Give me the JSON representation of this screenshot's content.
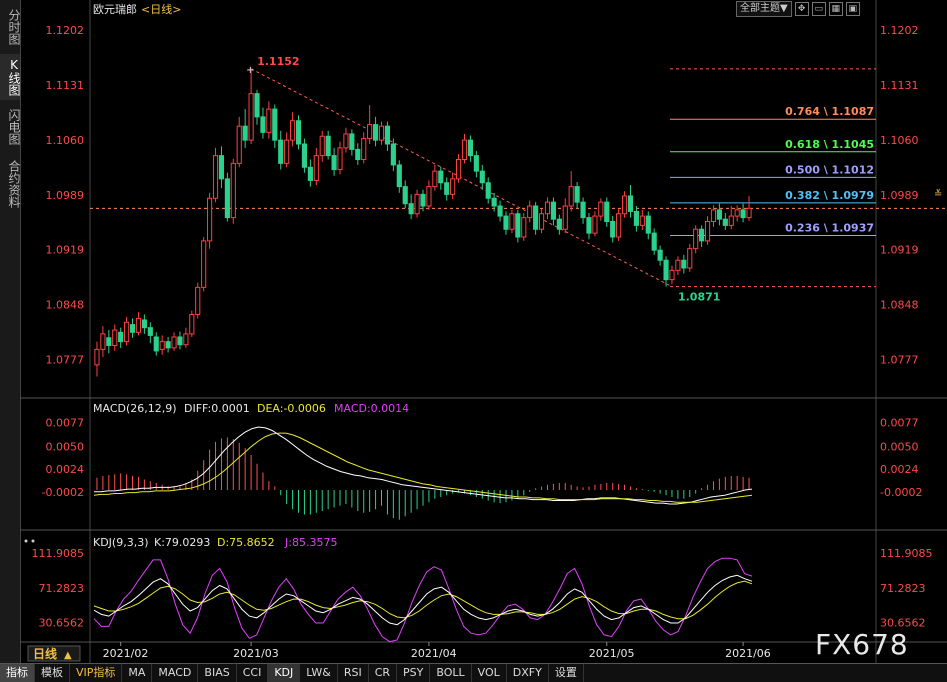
{
  "sidebar": {
    "tabs": [
      {
        "label": "分时图",
        "active": false
      },
      {
        "label": "K线图",
        "active": true
      },
      {
        "label": "闪电图",
        "active": false
      },
      {
        "label": "合约资料",
        "active": false
      }
    ]
  },
  "header": {
    "symbol": "欧元瑞郎",
    "period": "<日线>",
    "theme_button": "全部主题",
    "theme_caret": "▼"
  },
  "main_chart": {
    "price_ticks": [
      "1.1202",
      "1.1131",
      "1.1060",
      "1.0989",
      "1.0919",
      "1.0848",
      "1.0777"
    ],
    "high_label": "1.1152",
    "low_label": "1.0871",
    "fib_levels": [
      {
        "label": "0.764 \\ 1.1087",
        "color": "#ff8c5a"
      },
      {
        "label": "0.618 \\ 1.1045",
        "color": "#4cff4c"
      },
      {
        "label": "0.500 \\ 1.1012",
        "color": "#a0a0ff"
      },
      {
        "label": "0.382 \\ 1.0979",
        "color": "#4fc3f7"
      },
      {
        "label": "0.236 \\ 1.0937",
        "color": "#a0a0ff"
      }
    ],
    "last_price_marker": "≚"
  },
  "macd": {
    "title": "MACD(26,12,9)",
    "diff": "DIFF:0.0001",
    "dea": "DEA:-0.0006",
    "macd": "MACD:0.0014",
    "ticks": [
      "0.0077",
      "0.0050",
      "0.0024",
      "-0.0002"
    ]
  },
  "kdj": {
    "title": "KDJ(9,3,3)",
    "k": "K:79.0293",
    "d": "D:75.8652",
    "j": "J:85.3575",
    "ticks": [
      "111.9085",
      "71.2823",
      "30.6562"
    ]
  },
  "x_axis": {
    "period_button": "日线",
    "dates": [
      "2021/02",
      "2021/03",
      "2021/04",
      "2021/05",
      "2021/06"
    ]
  },
  "bottom_tabs": [
    "指标",
    "模板",
    "VIP指标",
    "MA",
    "MACD",
    "BIAS",
    "CCI",
    "KDJ",
    "LW&",
    "RSI",
    "CR",
    "PSY",
    "BOLL",
    "VOL",
    "DXFY",
    "设置"
  ],
  "watermark": "FX678",
  "colors": {
    "up": "#ff4040",
    "down": "#2bd18c",
    "axis": "#ff4848",
    "diff_line": "#ffffff",
    "dea_line": "#e8e830",
    "j_line": "#e040fb"
  },
  "chart_data": {
    "type": "candlestick",
    "title": "欧元瑞郎 日线",
    "y_range": [
      1.0735,
      1.1215
    ],
    "x_labels": [
      "2021/02",
      "2021/03",
      "2021/04",
      "2021/05",
      "2021/06"
    ],
    "candles": [
      [
        1.077,
        1.079,
        1.0755,
        1.08
      ],
      [
        1.079,
        1.081,
        1.078,
        1.082
      ],
      [
        1.0805,
        1.0795,
        1.0785,
        1.0815
      ],
      [
        1.0795,
        1.0815,
        1.0788,
        1.0822
      ],
      [
        1.0812,
        1.08,
        1.0792,
        1.0818
      ],
      [
        1.08,
        1.0825,
        1.0795,
        1.0832
      ],
      [
        1.0822,
        1.0812,
        1.0805,
        1.083
      ],
      [
        1.0812,
        1.083,
        1.0808,
        1.0838
      ],
      [
        1.0828,
        1.0818,
        1.081,
        1.0835
      ],
      [
        1.0818,
        1.0808,
        1.0798,
        1.0825
      ],
      [
        1.0806,
        1.0788,
        1.0782,
        1.0812
      ],
      [
        1.079,
        1.08,
        1.0783,
        1.0808
      ],
      [
        1.08,
        1.0792,
        1.0786,
        1.0806
      ],
      [
        1.0792,
        1.0806,
        1.0788,
        1.0812
      ],
      [
        1.0806,
        1.0796,
        1.079,
        1.0813
      ],
      [
        1.0796,
        1.081,
        1.0792,
        1.0818
      ],
      [
        1.081,
        1.0835,
        1.0806,
        1.084
      ],
      [
        1.0835,
        1.087,
        1.083,
        1.0876
      ],
      [
        1.087,
        1.093,
        1.0865,
        1.0935
      ],
      [
        1.093,
        1.0985,
        1.092,
        1.0992
      ],
      [
        1.0985,
        1.104,
        1.098,
        1.105
      ],
      [
        1.104,
        1.101,
        1.0998,
        1.1052
      ],
      [
        1.101,
        1.096,
        1.0955,
        1.1018
      ],
      [
        1.096,
        1.103,
        1.0952,
        1.1036
      ],
      [
        1.103,
        1.1078,
        1.1025,
        1.109
      ],
      [
        1.1078,
        1.106,
        1.105,
        1.11
      ],
      [
        1.106,
        1.112,
        1.1055,
        1.1152
      ],
      [
        1.112,
        1.109,
        1.108,
        1.1125
      ],
      [
        1.109,
        1.107,
        1.1062,
        1.1102
      ],
      [
        1.107,
        1.11,
        1.1062,
        1.111
      ],
      [
        1.11,
        1.106,
        1.105,
        1.1106
      ],
      [
        1.106,
        1.103,
        1.1022,
        1.1072
      ],
      [
        1.103,
        1.106,
        1.1025,
        1.107
      ],
      [
        1.106,
        1.1085,
        1.1052,
        1.1096
      ],
      [
        1.1085,
        1.1055,
        1.1048,
        1.1092
      ],
      [
        1.1055,
        1.1025,
        1.1018,
        1.1062
      ],
      [
        1.1025,
        1.1008,
        1.1,
        1.1035
      ],
      [
        1.1008,
        1.104,
        1.1002,
        1.105
      ],
      [
        1.104,
        1.1065,
        1.1032,
        1.1072
      ],
      [
        1.1065,
        1.104,
        1.1035,
        1.1072
      ],
      [
        1.104,
        1.1022,
        1.1014,
        1.105
      ],
      [
        1.1022,
        1.105,
        1.1016,
        1.1058
      ],
      [
        1.105,
        1.1068,
        1.1044,
        1.1076
      ],
      [
        1.1068,
        1.1048,
        1.104,
        1.1074
      ],
      [
        1.1048,
        1.1035,
        1.1028,
        1.1056
      ],
      [
        1.1035,
        1.1062,
        1.103,
        1.107
      ],
      [
        1.1062,
        1.108,
        1.1055,
        1.1105
      ],
      [
        1.108,
        1.106,
        1.1052,
        1.109
      ],
      [
        1.106,
        1.1078,
        1.1054,
        1.1084
      ],
      [
        1.1078,
        1.1055,
        1.1046,
        1.1084
      ],
      [
        1.1055,
        1.1028,
        1.102,
        1.1062
      ],
      [
        1.1028,
        1.1,
        1.0992,
        1.1034
      ],
      [
        1.1,
        1.0978,
        1.0972,
        1.1008
      ],
      [
        1.0978,
        1.0965,
        1.0958,
        1.099
      ],
      [
        1.0965,
        1.099,
        1.096,
        1.0996
      ],
      [
        1.099,
        1.0975,
        1.0968,
        1.0996
      ],
      [
        1.0975,
        1.1,
        1.097,
        1.1008
      ],
      [
        1.1,
        1.102,
        1.0995,
        1.1028
      ],
      [
        1.102,
        1.1005,
        1.0996,
        1.1026
      ],
      [
        1.1005,
        1.099,
        1.0982,
        1.1012
      ],
      [
        1.099,
        1.101,
        1.0984,
        1.1018
      ],
      [
        1.101,
        1.1035,
        1.1005,
        1.1042
      ],
      [
        1.1035,
        1.106,
        1.103,
        1.1068
      ],
      [
        1.106,
        1.104,
        1.1032,
        1.1066
      ],
      [
        1.104,
        1.102,
        1.1012,
        1.1046
      ],
      [
        1.102,
        1.1005,
        1.0996,
        1.1028
      ],
      [
        1.1005,
        1.0985,
        1.0978,
        1.1012
      ],
      [
        1.0985,
        1.0975,
        1.0968,
        1.0992
      ],
      [
        1.0975,
        1.0962,
        1.0955,
        1.0982
      ],
      [
        1.0962,
        1.0945,
        1.0938,
        1.0968
      ],
      [
        1.0945,
        1.0965,
        1.094,
        1.097
      ],
      [
        1.0965,
        1.0935,
        1.0928,
        1.097
      ],
      [
        1.0935,
        1.096,
        1.093,
        1.0966
      ],
      [
        1.096,
        1.0975,
        1.0954,
        1.0982
      ],
      [
        1.0975,
        1.0945,
        1.0938,
        1.098
      ],
      [
        1.0945,
        1.0965,
        1.094,
        1.0972
      ],
      [
        1.0965,
        1.098,
        1.0958,
        1.0986
      ],
      [
        1.098,
        1.0958,
        1.095,
        1.0986
      ],
      [
        1.0958,
        1.0945,
        1.0938,
        1.0964
      ],
      [
        1.0945,
        1.0975,
        1.094,
        1.0985
      ],
      [
        1.0975,
        1.1,
        1.0968,
        1.102
      ],
      [
        1.1,
        1.098,
        1.0972,
        1.1006
      ],
      [
        1.098,
        1.096,
        1.0952,
        1.0986
      ],
      [
        1.096,
        1.094,
        1.0932,
        1.0966
      ],
      [
        1.094,
        1.0962,
        1.0936,
        1.0968
      ],
      [
        1.0962,
        1.098,
        1.0956,
        1.0985
      ],
      [
        1.098,
        1.0955,
        1.0948,
        1.0986
      ],
      [
        1.0955,
        1.0935,
        1.0928,
        1.0962
      ],
      [
        1.0935,
        1.0965,
        1.093,
        1.0972
      ],
      [
        1.0965,
        1.0988,
        1.096,
        1.0994
      ],
      [
        1.0988,
        1.0968,
        1.096,
        1.1002
      ],
      [
        1.0968,
        1.095,
        1.0942,
        1.0975
      ],
      [
        1.095,
        1.0962,
        1.0944,
        1.097
      ],
      [
        1.0962,
        1.094,
        1.0932,
        1.0968
      ],
      [
        1.094,
        1.0918,
        1.0912,
        1.0946
      ],
      [
        1.0918,
        1.0905,
        1.0898,
        1.0924
      ],
      [
        1.0905,
        1.088,
        1.0871,
        1.091
      ],
      [
        1.088,
        1.0892,
        1.0874,
        1.0898
      ],
      [
        1.0892,
        1.0905,
        1.0886,
        1.091
      ],
      [
        1.0905,
        1.0895,
        1.0888,
        1.0912
      ],
      [
        1.0895,
        1.092,
        1.089,
        1.0926
      ],
      [
        1.092,
        1.0945,
        1.0914,
        1.095
      ],
      [
        1.0945,
        1.093,
        1.0922,
        1.095
      ],
      [
        1.093,
        1.0955,
        1.0925,
        1.0962
      ],
      [
        1.0955,
        1.097,
        1.0948,
        1.0976
      ],
      [
        1.097,
        1.0958,
        1.095,
        1.0978
      ],
      [
        1.0958,
        1.095,
        1.0944,
        1.0966
      ],
      [
        1.095,
        1.0962,
        1.0945,
        1.0975
      ],
      [
        1.0962,
        1.097,
        1.0955,
        1.0976
      ],
      [
        1.097,
        1.096,
        1.0954,
        1.0978
      ],
      [
        1.096,
        1.0972,
        1.0956,
        1.0988
      ]
    ],
    "macd_hist": [
      0.0014,
      0.0016,
      0.0017,
      0.0018,
      0.0019,
      0.0018,
      0.0016,
      0.0015,
      0.0012,
      0.001,
      0.0008,
      0.0006,
      0.0004,
      0.0003,
      0.0004,
      0.0007,
      0.0012,
      0.0022,
      0.0034,
      0.0046,
      0.0055,
      0.0059,
      0.006,
      0.0058,
      0.0054,
      0.0048,
      0.004,
      0.003,
      0.002,
      0.001,
      0.0004,
      -0.0006,
      -0.0016,
      -0.0022,
      -0.0026,
      -0.0028,
      -0.0028,
      -0.0026,
      -0.0024,
      -0.0022,
      -0.002,
      -0.0018,
      -0.0016,
      -0.002,
      -0.0024,
      -0.0026,
      -0.0025,
      -0.0022,
      -0.0018,
      -0.0028,
      -0.0032,
      -0.0034,
      -0.003,
      -0.0026,
      -0.0022,
      -0.0018,
      -0.0014,
      -0.001,
      -0.0008,
      -0.0006,
      -0.0004,
      -0.0003,
      -0.0004,
      -0.0006,
      -0.0008,
      -0.001,
      -0.0012,
      -0.0014,
      -0.0015,
      -0.0014,
      -0.0012,
      -0.001,
      -0.0006,
      -0.0002,
      0.0002,
      0.0004,
      0.0006,
      0.0007,
      0.0008,
      0.0008,
      0.0006,
      0.0004,
      0.0003,
      0.0004,
      0.0006,
      0.0007,
      0.0008,
      0.0008,
      0.0007,
      0.0006,
      0.0004,
      0.0002,
      0.0001,
      -0.0001,
      -0.0002,
      -0.0004,
      -0.0006,
      -0.0008,
      -0.001,
      -0.001,
      -0.0008,
      -0.0004,
      0.0002,
      0.0006,
      0.001,
      0.0013,
      0.0015,
      0.0016,
      0.0016,
      0.0015,
      0.0014
    ],
    "macd_diff": [
      -0.0002,
      -0.0002,
      -0.0001,
      -0.0001,
      0.0,
      0.0001,
      0.0001,
      0.0002,
      0.0002,
      0.0003,
      0.0003,
      0.0003,
      0.0004,
      0.0006,
      0.0009,
      0.0013,
      0.0019,
      0.0027,
      0.0036,
      0.0045,
      0.0053,
      0.006,
      0.0066,
      0.007,
      0.0072,
      0.0071,
      0.0068,
      0.0063,
      0.0058,
      0.0052,
      0.0046,
      0.004,
      0.0035,
      0.0031,
      0.0027,
      0.0024,
      0.0021,
      0.0019,
      0.0017,
      0.0016,
      0.0014,
      0.0013,
      0.0012,
      0.001,
      0.0008,
      0.0006,
      0.0005,
      0.0004,
      0.0003,
      0.0002,
      0.0001,
      0.0,
      -0.0001,
      -0.0002,
      -0.0003,
      -0.0004,
      -0.0005,
      -0.0006,
      -0.0007,
      -0.0008,
      -0.0009,
      -0.0009,
      -0.001,
      -0.001,
      -0.0011,
      -0.0011,
      -0.0011,
      -0.0012,
      -0.0012,
      -0.0012,
      -0.0012,
      -0.0011,
      -0.001,
      -0.001,
      -0.0009,
      -0.0009,
      -0.0009,
      -0.001,
      -0.0011,
      -0.0012,
      -0.0013,
      -0.0014,
      -0.0015,
      -0.0015,
      -0.0016,
      -0.0016,
      -0.0015,
      -0.0014,
      -0.0012,
      -0.001,
      -0.0008,
      -0.0007,
      -0.0006,
      -0.0004,
      -0.0002,
      0.0,
      0.0001
    ],
    "macd_dea": [
      -0.0006,
      -0.0005,
      -0.0005,
      -0.0004,
      -0.0004,
      -0.0003,
      -0.0003,
      -0.0002,
      -0.0002,
      -0.0001,
      -0.0001,
      -0.0001,
      0.0,
      0.0001,
      0.0002,
      0.0004,
      0.0007,
      0.0011,
      0.0016,
      0.0022,
      0.0029,
      0.0036,
      0.0043,
      0.005,
      0.0056,
      0.0061,
      0.0064,
      0.0065,
      0.0065,
      0.0063,
      0.006,
      0.0056,
      0.0052,
      0.0048,
      0.0044,
      0.004,
      0.0036,
      0.0032,
      0.0029,
      0.0026,
      0.0023,
      0.0021,
      0.0019,
      0.0017,
      0.0015,
      0.0013,
      0.0011,
      0.0009,
      0.0007,
      0.0006,
      0.0004,
      0.0003,
      0.0002,
      0.0001,
      0.0,
      -0.0001,
      -0.0002,
      -0.0003,
      -0.0004,
      -0.0005,
      -0.0006,
      -0.0007,
      -0.0008,
      -0.0008,
      -0.0009,
      -0.0009,
      -0.001,
      -0.001,
      -0.0011,
      -0.0011,
      -0.0011,
      -0.0011,
      -0.0011,
      -0.0011,
      -0.001,
      -0.001,
      -0.001,
      -0.001,
      -0.001,
      -0.0011,
      -0.0011,
      -0.0012,
      -0.0012,
      -0.0013,
      -0.0013,
      -0.0014,
      -0.0014,
      -0.0014,
      -0.0014,
      -0.0013,
      -0.0012,
      -0.0011,
      -0.001,
      -0.0009,
      -0.0008,
      -0.0007,
      -0.0006
    ],
    "kdj_k": [
      45,
      40,
      38,
      44,
      50,
      55,
      62,
      70,
      78,
      82,
      76,
      64,
      52,
      44,
      48,
      58,
      68,
      74,
      70,
      58,
      46,
      38,
      36,
      42,
      50,
      58,
      64,
      62,
      56,
      50,
      44,
      42,
      46,
      52,
      56,
      60,
      58,
      52,
      44,
      36,
      30,
      28,
      34,
      44,
      54,
      64,
      70,
      72,
      66,
      56,
      46,
      40,
      36,
      34,
      36,
      40,
      44,
      46,
      44,
      40,
      38,
      40,
      46,
      54,
      64,
      70,
      66,
      56,
      46,
      38,
      34,
      36,
      42,
      48,
      50,
      46,
      40,
      34,
      30,
      30,
      36,
      46,
      56,
      66,
      74,
      80,
      84,
      86,
      82,
      79
    ],
    "kdj_d": [
      50,
      47,
      44,
      44,
      46,
      49,
      53,
      59,
      65,
      71,
      73,
      70,
      64,
      57,
      54,
      55,
      59,
      64,
      66,
      63,
      57,
      51,
      46,
      45,
      47,
      51,
      55,
      58,
      58,
      55,
      51,
      48,
      47,
      49,
      51,
      54,
      56,
      55,
      52,
      47,
      41,
      37,
      36,
      39,
      44,
      51,
      57,
      62,
      64,
      61,
      56,
      51,
      46,
      42,
      40,
      40,
      41,
      43,
      43,
      42,
      40,
      40,
      42,
      46,
      52,
      58,
      61,
      59,
      55,
      49,
      44,
      41,
      41,
      44,
      46,
      46,
      44,
      40,
      37,
      35,
      35,
      39,
      45,
      52,
      60,
      67,
      73,
      77,
      79,
      76
    ],
    "kdj_j": [
      35,
      26,
      26,
      44,
      58,
      67,
      80,
      92,
      104,
      104,
      82,
      52,
      28,
      18,
      36,
      64,
      86,
      94,
      78,
      48,
      24,
      12,
      16,
      36,
      56,
      72,
      82,
      70,
      52,
      40,
      30,
      30,
      44,
      58,
      66,
      72,
      62,
      46,
      28,
      14,
      8,
      10,
      30,
      54,
      74,
      90,
      96,
      92,
      70,
      46,
      26,
      18,
      16,
      18,
      28,
      40,
      50,
      52,
      46,
      36,
      34,
      40,
      54,
      70,
      88,
      94,
      76,
      50,
      28,
      16,
      14,
      26,
      44,
      56,
      58,
      46,
      32,
      22,
      16,
      20,
      38,
      60,
      78,
      94,
      102,
      106,
      106,
      104,
      88,
      85
    ]
  }
}
